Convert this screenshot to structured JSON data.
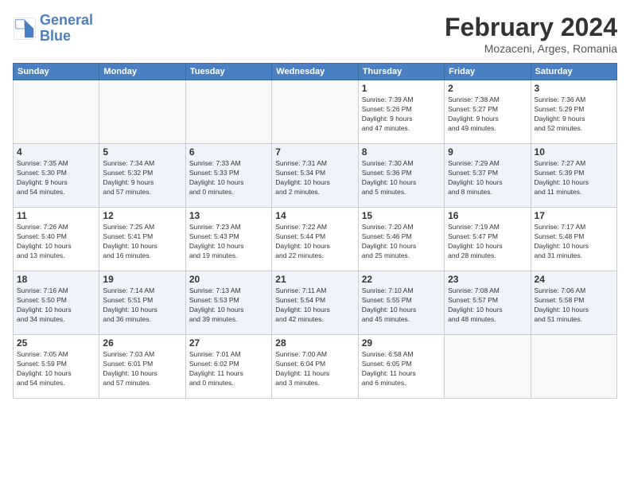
{
  "logo": {
    "line1": "General",
    "line2": "Blue"
  },
  "title": "February 2024",
  "subtitle": "Mozaceni, Arges, Romania",
  "days_of_week": [
    "Sunday",
    "Monday",
    "Tuesday",
    "Wednesday",
    "Thursday",
    "Friday",
    "Saturday"
  ],
  "weeks": [
    [
      {
        "day": "",
        "info": ""
      },
      {
        "day": "",
        "info": ""
      },
      {
        "day": "",
        "info": ""
      },
      {
        "day": "",
        "info": ""
      },
      {
        "day": "1",
        "info": "Sunrise: 7:39 AM\nSunset: 5:26 PM\nDaylight: 9 hours\nand 47 minutes."
      },
      {
        "day": "2",
        "info": "Sunrise: 7:38 AM\nSunset: 5:27 PM\nDaylight: 9 hours\nand 49 minutes."
      },
      {
        "day": "3",
        "info": "Sunrise: 7:36 AM\nSunset: 5:29 PM\nDaylight: 9 hours\nand 52 minutes."
      }
    ],
    [
      {
        "day": "4",
        "info": "Sunrise: 7:35 AM\nSunset: 5:30 PM\nDaylight: 9 hours\nand 54 minutes."
      },
      {
        "day": "5",
        "info": "Sunrise: 7:34 AM\nSunset: 5:32 PM\nDaylight: 9 hours\nand 57 minutes."
      },
      {
        "day": "6",
        "info": "Sunrise: 7:33 AM\nSunset: 5:33 PM\nDaylight: 10 hours\nand 0 minutes."
      },
      {
        "day": "7",
        "info": "Sunrise: 7:31 AM\nSunset: 5:34 PM\nDaylight: 10 hours\nand 2 minutes."
      },
      {
        "day": "8",
        "info": "Sunrise: 7:30 AM\nSunset: 5:36 PM\nDaylight: 10 hours\nand 5 minutes."
      },
      {
        "day": "9",
        "info": "Sunrise: 7:29 AM\nSunset: 5:37 PM\nDaylight: 10 hours\nand 8 minutes."
      },
      {
        "day": "10",
        "info": "Sunrise: 7:27 AM\nSunset: 5:39 PM\nDaylight: 10 hours\nand 11 minutes."
      }
    ],
    [
      {
        "day": "11",
        "info": "Sunrise: 7:26 AM\nSunset: 5:40 PM\nDaylight: 10 hours\nand 13 minutes."
      },
      {
        "day": "12",
        "info": "Sunrise: 7:25 AM\nSunset: 5:41 PM\nDaylight: 10 hours\nand 16 minutes."
      },
      {
        "day": "13",
        "info": "Sunrise: 7:23 AM\nSunset: 5:43 PM\nDaylight: 10 hours\nand 19 minutes."
      },
      {
        "day": "14",
        "info": "Sunrise: 7:22 AM\nSunset: 5:44 PM\nDaylight: 10 hours\nand 22 minutes."
      },
      {
        "day": "15",
        "info": "Sunrise: 7:20 AM\nSunset: 5:46 PM\nDaylight: 10 hours\nand 25 minutes."
      },
      {
        "day": "16",
        "info": "Sunrise: 7:19 AM\nSunset: 5:47 PM\nDaylight: 10 hours\nand 28 minutes."
      },
      {
        "day": "17",
        "info": "Sunrise: 7:17 AM\nSunset: 5:48 PM\nDaylight: 10 hours\nand 31 minutes."
      }
    ],
    [
      {
        "day": "18",
        "info": "Sunrise: 7:16 AM\nSunset: 5:50 PM\nDaylight: 10 hours\nand 34 minutes."
      },
      {
        "day": "19",
        "info": "Sunrise: 7:14 AM\nSunset: 5:51 PM\nDaylight: 10 hours\nand 36 minutes."
      },
      {
        "day": "20",
        "info": "Sunrise: 7:13 AM\nSunset: 5:53 PM\nDaylight: 10 hours\nand 39 minutes."
      },
      {
        "day": "21",
        "info": "Sunrise: 7:11 AM\nSunset: 5:54 PM\nDaylight: 10 hours\nand 42 minutes."
      },
      {
        "day": "22",
        "info": "Sunrise: 7:10 AM\nSunset: 5:55 PM\nDaylight: 10 hours\nand 45 minutes."
      },
      {
        "day": "23",
        "info": "Sunrise: 7:08 AM\nSunset: 5:57 PM\nDaylight: 10 hours\nand 48 minutes."
      },
      {
        "day": "24",
        "info": "Sunrise: 7:06 AM\nSunset: 5:58 PM\nDaylight: 10 hours\nand 51 minutes."
      }
    ],
    [
      {
        "day": "25",
        "info": "Sunrise: 7:05 AM\nSunset: 5:59 PM\nDaylight: 10 hours\nand 54 minutes."
      },
      {
        "day": "26",
        "info": "Sunrise: 7:03 AM\nSunset: 6:01 PM\nDaylight: 10 hours\nand 57 minutes."
      },
      {
        "day": "27",
        "info": "Sunrise: 7:01 AM\nSunset: 6:02 PM\nDaylight: 11 hours\nand 0 minutes."
      },
      {
        "day": "28",
        "info": "Sunrise: 7:00 AM\nSunset: 6:04 PM\nDaylight: 11 hours\nand 3 minutes."
      },
      {
        "day": "29",
        "info": "Sunrise: 6:58 AM\nSunset: 6:05 PM\nDaylight: 11 hours\nand 6 minutes."
      },
      {
        "day": "",
        "info": ""
      },
      {
        "day": "",
        "info": ""
      }
    ]
  ]
}
